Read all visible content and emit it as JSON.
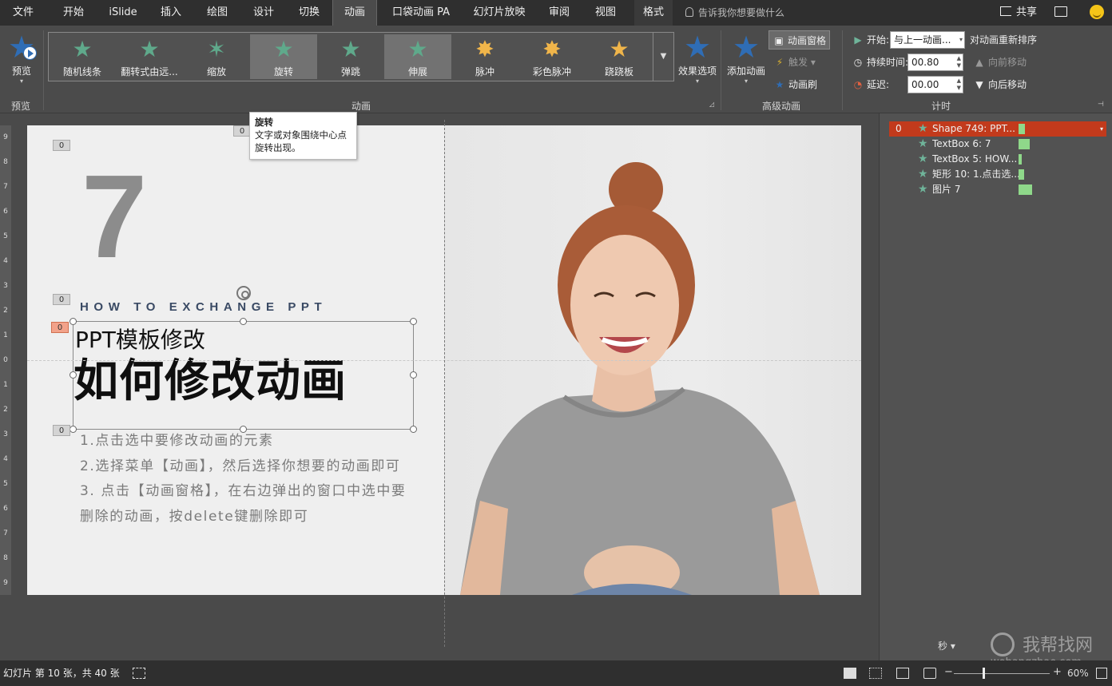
{
  "menu_tabs": [
    "文件",
    "开始",
    "iSlide",
    "插入",
    "绘图",
    "设计",
    "切换",
    "动画",
    "口袋动画 PA",
    "幻灯片放映",
    "审阅",
    "视图",
    "格式"
  ],
  "active_tab": "动画",
  "tell_me": "告诉我你想要做什么",
  "share_label": "共享",
  "ribbon": {
    "preview": {
      "label": "预览",
      "group": "预览"
    },
    "gallery": [
      {
        "label": "随机线条",
        "color": "#5fa98b"
      },
      {
        "label": "翻转式由远...",
        "color": "#5fa98b"
      },
      {
        "label": "缩放",
        "color": "#5fa98b"
      },
      {
        "label": "旋转",
        "color": "#5fa98b"
      },
      {
        "label": "弹跳",
        "color": "#5fa98b"
      },
      {
        "label": "伸展",
        "color": "#5fa98b"
      },
      {
        "label": "脉冲",
        "color": "#f0b54a"
      },
      {
        "label": "彩色脉冲",
        "color": "#f0b54a"
      },
      {
        "label": "跷跷板",
        "color": "#f0b54a"
      }
    ],
    "animation_group": "动画",
    "effect_options": "效果选项",
    "add_animation": "添加动画",
    "animation_pane_btn": "动画窗格",
    "trigger": "触发",
    "painter": "动画刷",
    "advanced_group": "高级动画",
    "start_label": "开始:",
    "start_value": "与上一动画...",
    "duration_label": "持续时间:",
    "duration_value": "00.80",
    "delay_label": "延迟:",
    "delay_value": "00.00",
    "reorder": "对动画重新排序",
    "move_earlier": "向前移动",
    "move_later": "向后移动",
    "timing_group": "计时"
  },
  "tooltip": {
    "title": "旋转",
    "body": "文字或对象围绕中心点旋转出现。"
  },
  "slide": {
    "number": "7",
    "subtitle": "HOW TO EXCHANGE PPT",
    "title1": "PPT模板修改",
    "title2": "如何修改动画",
    "steps": [
      "1.点击选中要修改动画的元素",
      "2.选择菜单【动画】，然后选择你想要的动画即可",
      "3. 点击【动画窗格】，在右边弹出的窗口中选中要删除的动画，按delete键删除即可"
    ],
    "anim_tags": [
      "0",
      "0",
      "0",
      "0",
      "0"
    ]
  },
  "ruler_numbers": [
    "9",
    "8",
    "7",
    "6",
    "5",
    "4",
    "3",
    "2",
    "1",
    "0",
    "1",
    "2",
    "3",
    "4",
    "5",
    "6",
    "7",
    "8",
    "9"
  ],
  "animation_pane": {
    "items": [
      {
        "num": "0",
        "name": "Shape 749: PPT...",
        "selected": true,
        "bar": 0.04
      },
      {
        "num": "",
        "name": "TextBox 6: 7",
        "selected": false,
        "bar": 0.08
      },
      {
        "num": "",
        "name": "TextBox 5: HOW...",
        "selected": false,
        "bar": 0.02
      },
      {
        "num": "",
        "name": "矩形 10: 1.点击选...",
        "selected": false,
        "bar": 0.03
      },
      {
        "num": "",
        "name": "图片 7",
        "selected": false,
        "bar": 0.1
      }
    ],
    "seconds_label": "秒",
    "watermark_1": "我帮找网",
    "watermark_2": "wobangzhao.com"
  },
  "status": {
    "slide_info": "幻灯片 第 10 张，共 40 张",
    "zoom": "60%"
  },
  "colors": {
    "accent": "#2f6db5",
    "selected_row": "#c23a1c",
    "bar": "#8fd88a"
  }
}
